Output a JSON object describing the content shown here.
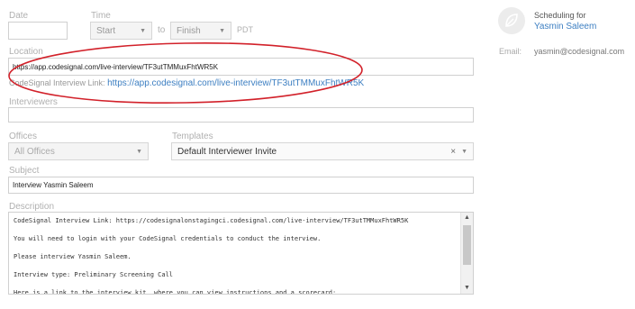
{
  "date": {
    "label": "Date",
    "value": ""
  },
  "time": {
    "label": "Time",
    "start": "Start",
    "to": "to",
    "finish": "Finish",
    "timezone": "PDT"
  },
  "location": {
    "label": "Location",
    "value": "https://app.codesignal.com/live-interview/TF3utTMMuxFhtWR5K",
    "link_prefix": "CodeSignal Interview Link:",
    "link_url": "https://app.codesignal.com/live-interview/TF3utTMMuxFhtWR5K"
  },
  "interviewers": {
    "label": "Interviewers",
    "value": ""
  },
  "offices": {
    "label": "Offices",
    "selected": "All Offices"
  },
  "templates": {
    "label": "Templates",
    "selected": "Default Interviewer Invite",
    "clear": "×"
  },
  "subject": {
    "label": "Subject",
    "value": "Interview Yasmin Saleem"
  },
  "description": {
    "label": "Description",
    "lines": [
      "CodeSignal Interview Link: https://codesignalonstagingci.codesignal.com/live-interview/TF3utTMMuxFhtWR5K",
      "You will need to login with your CodeSignal credentials to conduct the interview.",
      "Please interview Yasmin Saleem.",
      "Interview type: Preliminary Screening Call",
      "Here is a link to the interview kit, where you can view instructions and a scorecard:"
    ]
  },
  "sidebar": {
    "scheduling_label": "Scheduling for",
    "candidate_name": "Yasmin Saleem",
    "email_label": "Email:",
    "email_value": "yasmin@codesignal.com"
  },
  "colors": {
    "link": "#3d7fc2",
    "annotation": "#d2212a"
  },
  "icons": {
    "avatar": "leaf-icon",
    "dropdown": "caret-down-icon"
  }
}
